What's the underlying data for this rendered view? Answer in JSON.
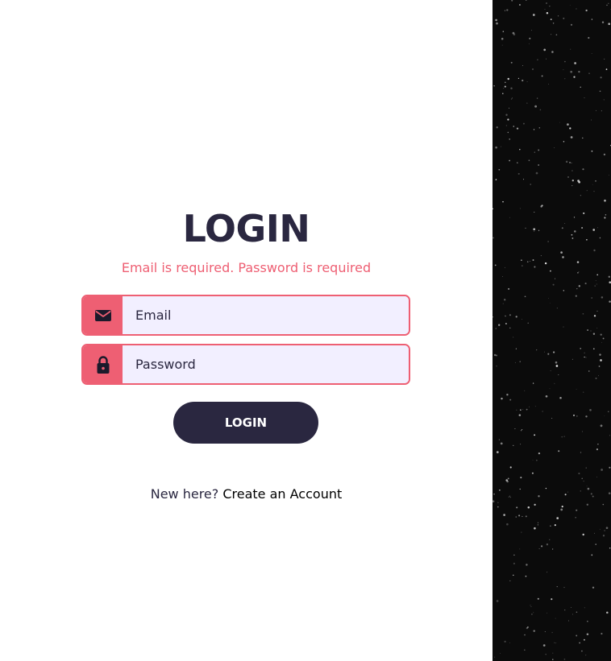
{
  "login": {
    "title": "LOGIN",
    "error_message": "Email is required. Password is required",
    "email": {
      "placeholder": "Email",
      "value": "",
      "icon": "mail-icon"
    },
    "password": {
      "placeholder": "Password",
      "value": "",
      "icon": "lock-icon"
    },
    "submit_label": "LOGIN",
    "signup_prompt": "New here?",
    "signup_link": "Create an Account"
  },
  "colors": {
    "accent": "#ee5f73",
    "dark": "#2a2740",
    "input_bg": "#f2efff",
    "side_panel": "#0b0b0b"
  }
}
